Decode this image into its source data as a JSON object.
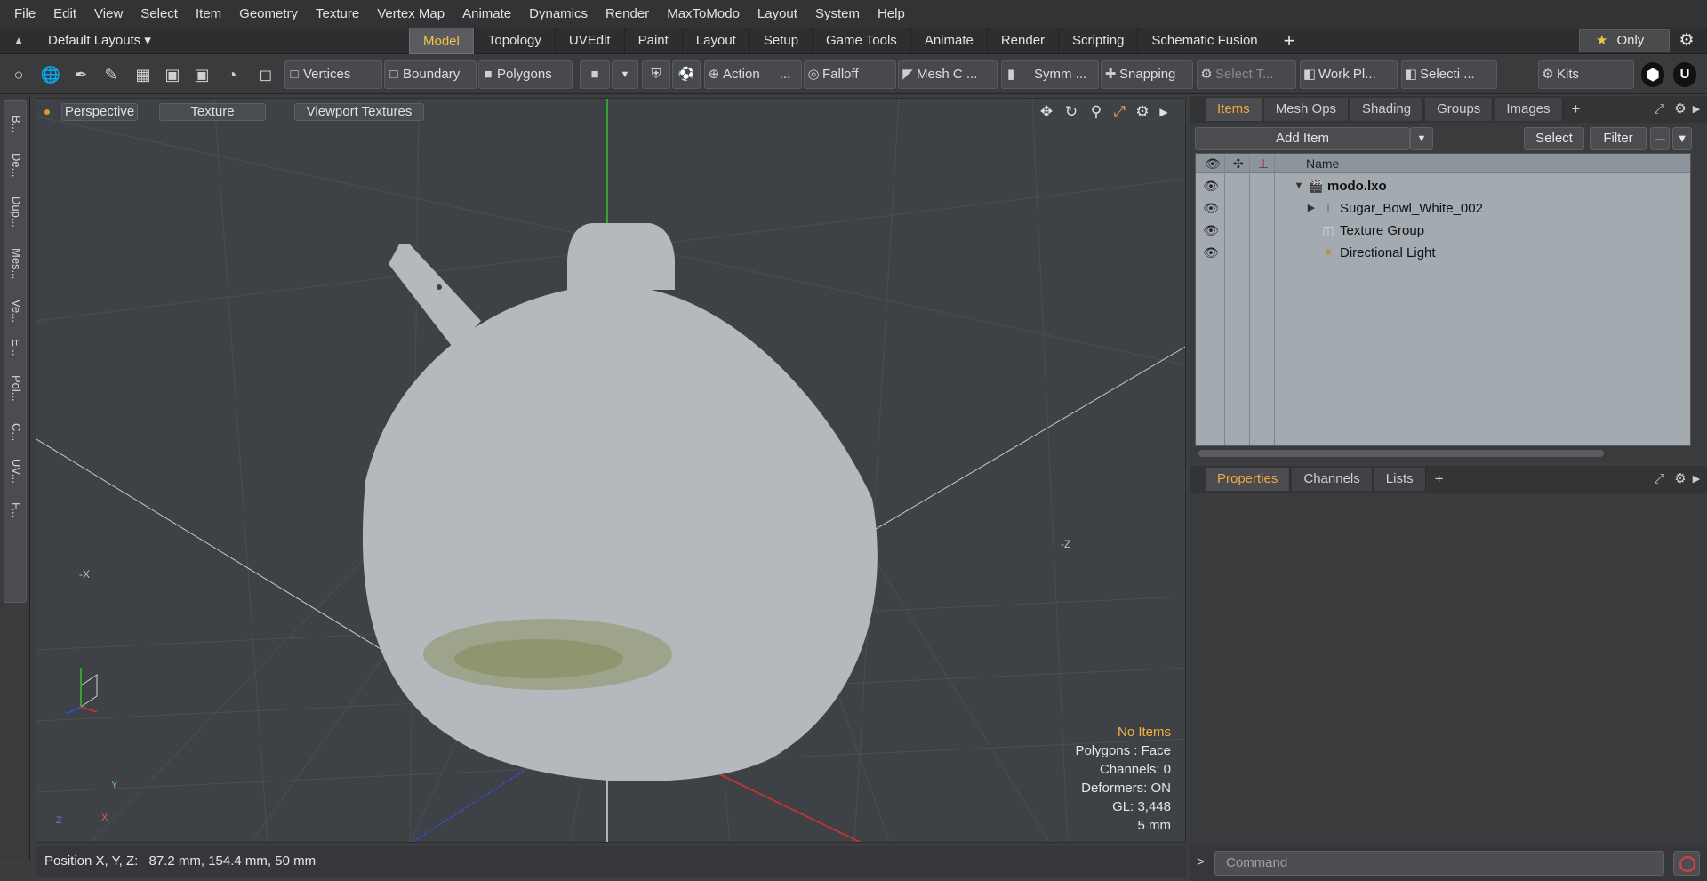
{
  "menu": [
    "File",
    "Edit",
    "View",
    "Select",
    "Item",
    "Geometry",
    "Texture",
    "Vertex Map",
    "Animate",
    "Dynamics",
    "Render",
    "MaxToModo",
    "Layout",
    "System",
    "Help"
  ],
  "layoutbar": {
    "layouts_label": "Default Layouts ▾",
    "tabs": [
      "Model",
      "Topology",
      "UVEdit",
      "Paint",
      "Layout",
      "Setup",
      "Game Tools",
      "Animate",
      "Render",
      "Scripting",
      "Schematic Fusion"
    ],
    "active_tab": "Model",
    "add_tab": "+",
    "only_label": "Only",
    "star": "★"
  },
  "toolbar": {
    "vertices": "Vertices",
    "boundary": "Boundary",
    "polygons": "Polygons",
    "action": "Action",
    "action_more": "...",
    "falloff": "Falloff",
    "mesh_c": "Mesh C ...",
    "symm": "Symm ...",
    "snapping": "Snapping",
    "select_t": "Select T...",
    "work_pl": "Work Pl...",
    "selecti": "Selecti ...",
    "kits": "Kits"
  },
  "leftstrip": [
    "B...",
    "De...",
    "Dup...",
    "Mes...",
    "Ve...",
    "E...",
    "Pol...",
    "C...",
    "UV...",
    "F..."
  ],
  "viewport": {
    "view_mode": "Perspective",
    "shading": "Texture",
    "textures": "Viewport Textures",
    "info": {
      "selection": "No Items",
      "polygons": "Polygons : Face",
      "channels": "Channels: 0",
      "deformers": "Deformers: ON",
      "gl": "GL: 3,448",
      "scale": "5 mm"
    },
    "axis_labels": {
      "x": "X",
      "y": "Y",
      "z": "Z",
      "neg_x": "-X",
      "neg_z": "-Z"
    }
  },
  "status": {
    "position_label": "Position X, Y, Z:",
    "position_value": "87.2 mm, 154.4 mm, 50 mm"
  },
  "items_panel": {
    "tabs": [
      "Items",
      "Mesh Ops",
      "Shading",
      "Groups",
      "Images"
    ],
    "active_tab": "Items",
    "add_tab": "+",
    "add_item": "Add Item",
    "select_btn": "Select",
    "filter_btn": "Filter",
    "column_name": "Name",
    "items": [
      {
        "label": "modo.lxo",
        "bold": true,
        "indent": 0,
        "expander": "▼"
      },
      {
        "label": "Sugar_Bowl_White_002",
        "bold": false,
        "indent": 1,
        "expander": "▶"
      },
      {
        "label": "Texture Group",
        "bold": false,
        "indent": 1,
        "expander": ""
      },
      {
        "label": "Directional Light",
        "bold": false,
        "indent": 1,
        "expander": ""
      }
    ]
  },
  "props_panel": {
    "tabs": [
      "Properties",
      "Channels",
      "Lists"
    ],
    "active_tab": "Properties",
    "add_tab": "+"
  },
  "command": {
    "prompt": ">",
    "placeholder": "Command"
  },
  "colors": {
    "accent": "#f3c14a",
    "tab_active": "#f3a83a",
    "warning": "#f0b43c",
    "viewport_bg": "#3e4145",
    "model_fill": "#b3b9bd",
    "axis_x": "#e03030",
    "axis_y": "#30c030",
    "axis_z": "#3050e0"
  }
}
